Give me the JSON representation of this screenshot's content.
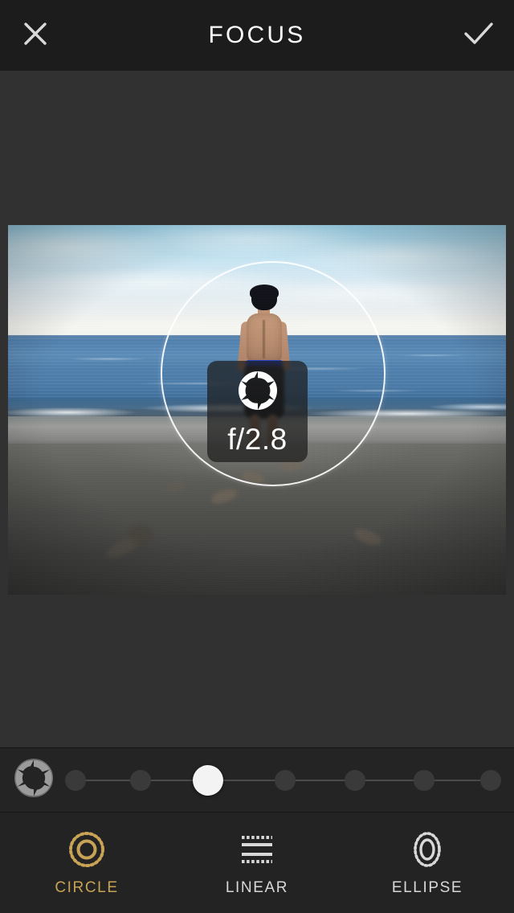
{
  "header": {
    "title": "FOCUS",
    "close_icon": "close-x-icon",
    "confirm_icon": "checkmark-icon"
  },
  "editor": {
    "tool": "Focus",
    "shape": "circle",
    "overlay_badge": {
      "icon": "aperture-icon",
      "value": "f/2.8"
    },
    "photo": {
      "description": "Boy standing at the shoreline facing the ocean, footprints in dark sand",
      "alt": "beach-photo"
    }
  },
  "slider": {
    "icon": "aperture-icon",
    "selected_index": 2,
    "stops": [
      {
        "index": 0,
        "position_pct": 0
      },
      {
        "index": 1,
        "position_pct": 16
      },
      {
        "index": 2,
        "position_pct": 32
      },
      {
        "index": 3,
        "position_pct": 51
      },
      {
        "index": 4,
        "position_pct": 68
      },
      {
        "index": 5,
        "position_pct": 84
      },
      {
        "index": 6,
        "position_pct": 100
      }
    ]
  },
  "tabs": {
    "active": "CIRCLE",
    "accent_color": "#c8a355",
    "inactive_color": "#d8d8d8",
    "items": [
      {
        "label": "CIRCLE",
        "icon": "circle-focus-icon",
        "active": true
      },
      {
        "label": "LINEAR",
        "icon": "linear-focus-icon",
        "active": false
      },
      {
        "label": "ELLIPSE",
        "icon": "ellipse-focus-icon",
        "active": false
      }
    ]
  },
  "theme": {
    "header_bg": "#1c1c1c",
    "canvas_bg": "#313131",
    "slider_bg": "#242424",
    "tabbar_bg": "#232323"
  }
}
